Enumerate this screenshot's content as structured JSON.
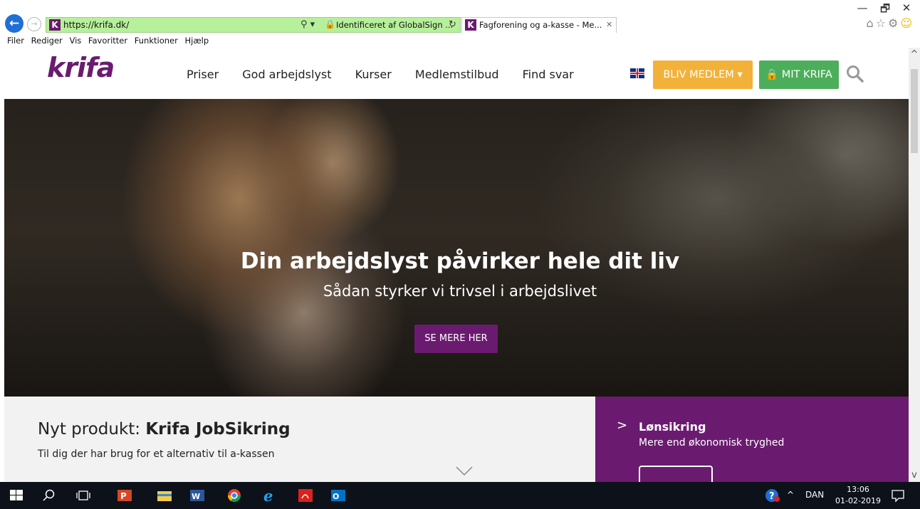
{
  "browser": {
    "url": "https://krifa.dk/",
    "certificate": "Identificeret af GlobalSign ...",
    "tab_title": "Fagforening og a-kasse - Me...",
    "menu": [
      "Filer",
      "Rediger",
      "Vis",
      "Favoritter",
      "Funktioner",
      "Hjælp"
    ],
    "window_controls": {
      "minimize": "—",
      "restore": "🗗",
      "close": "✕"
    },
    "toolbar_icons": [
      "home-icon",
      "star-icon",
      "gear-icon",
      "smiley-icon"
    ]
  },
  "site": {
    "logo": "krifa",
    "nav": [
      "Priser",
      "God arbejdslyst",
      "Kurser",
      "Medlemstilbud",
      "Find svar"
    ],
    "language_flag": "uk-flag-icon",
    "bliv_medlem": "BLIV MEDLEM ▾",
    "mit_krifa": "🔒 MIT KRIFA",
    "colors": {
      "brand": "#6a1b6f",
      "orange": "#f2b23a",
      "green": "#4cae5b"
    }
  },
  "hero": {
    "title": "Din arbejdslyst påvirker hele dit liv",
    "subtitle": "Sådan styrker vi trivsel i arbejdslivet",
    "button": "SE MERE HER"
  },
  "promo": {
    "title_prefix": "Nyt produkt: ",
    "title_bold": "Krifa JobSikring",
    "text": "Til dig der har brug for et alternativ til a-kassen"
  },
  "side_panel": {
    "arrow": ">",
    "title": "Lønsikring",
    "text": "Mere end økonomisk tryghed"
  },
  "taskbar": {
    "language": "DAN",
    "time": "13:06",
    "date": "01-02-2019"
  }
}
